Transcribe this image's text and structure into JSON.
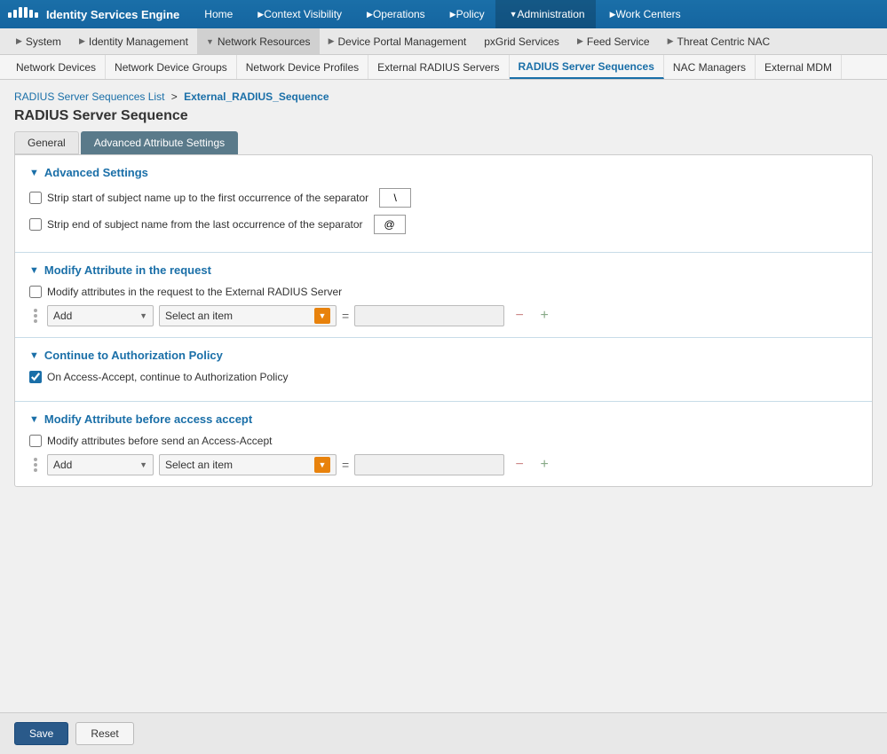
{
  "app": {
    "logo_alt": "Cisco",
    "title": "Identity Services Engine"
  },
  "top_nav": {
    "items": [
      {
        "label": "Home",
        "has_arrow": false
      },
      {
        "label": "Context Visibility",
        "has_arrow": true
      },
      {
        "label": "Operations",
        "has_arrow": true
      },
      {
        "label": "Policy",
        "has_arrow": true
      },
      {
        "label": "Administration",
        "has_arrow": true,
        "active": true
      },
      {
        "label": "Work Centers",
        "has_arrow": true
      }
    ]
  },
  "second_nav": {
    "items": [
      {
        "label": "System",
        "has_arrow": true
      },
      {
        "label": "Identity Management",
        "has_arrow": true
      },
      {
        "label": "Network Resources",
        "has_arrow": true,
        "active": true
      },
      {
        "label": "Device Portal Management",
        "has_arrow": true
      },
      {
        "label": "pxGrid Services",
        "has_arrow": false
      },
      {
        "label": "Feed Service",
        "has_arrow": true
      },
      {
        "label": "Threat Centric NAC",
        "has_arrow": true
      }
    ]
  },
  "third_nav": {
    "items": [
      {
        "label": "Network Devices"
      },
      {
        "label": "Network Device Groups"
      },
      {
        "label": "Network Device Profiles"
      },
      {
        "label": "External RADIUS Servers"
      },
      {
        "label": "RADIUS Server Sequences",
        "active": true
      },
      {
        "label": "NAC Managers"
      },
      {
        "label": "External MDM"
      }
    ]
  },
  "breadcrumb": {
    "list_label": "RADIUS Server Sequences List",
    "separator": ">",
    "current": "External_RADIUS_Sequence"
  },
  "page": {
    "title": "RADIUS Server Sequence",
    "tabs": [
      {
        "label": "General"
      },
      {
        "label": "Advanced Attribute Settings",
        "active": true
      }
    ]
  },
  "sections": {
    "advanced_settings": {
      "title": "Advanced Settings",
      "strip_start_label": "Strip start of subject name up to the first occurrence of the separator",
      "strip_start_checked": false,
      "strip_start_value": "\\",
      "strip_end_label": "Strip end of subject name from the last occurrence of the separator",
      "strip_end_checked": false,
      "strip_end_value": "@"
    },
    "modify_request": {
      "title": "Modify Attribute in the request",
      "checkbox_label": "Modify attributes in the request to the External RADIUS Server",
      "checked": false,
      "add_placeholder": "Add",
      "select_placeholder": "Select an item",
      "equals": "="
    },
    "authorization_policy": {
      "title": "Continue to Authorization Policy",
      "checkbox_label": "On Access-Accept, continue to Authorization Policy",
      "checked": true
    },
    "modify_access_accept": {
      "title": "Modify Attribute before access accept",
      "checkbox_label": "Modify attributes before send an Access-Accept",
      "checked": false,
      "add_placeholder": "Add",
      "select_placeholder": "Select an item",
      "equals": "="
    }
  },
  "footer": {
    "save_label": "Save",
    "reset_label": "Reset"
  }
}
